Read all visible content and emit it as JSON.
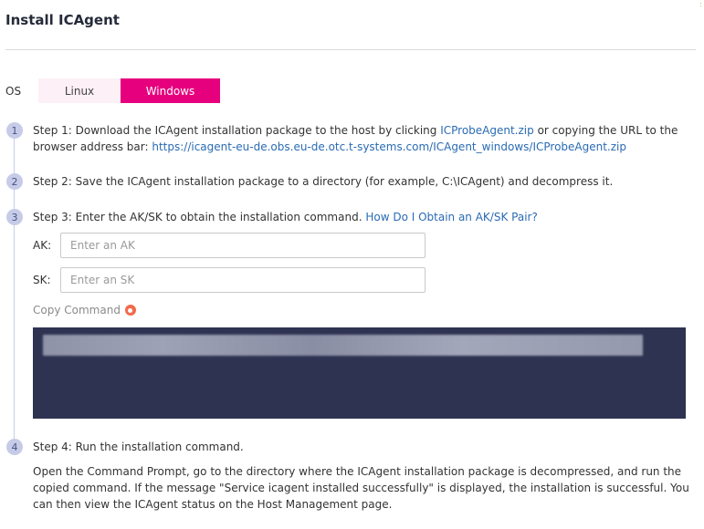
{
  "header": {
    "title": "Install ICAgent"
  },
  "os": {
    "label": "OS",
    "tabs": [
      {
        "label": "Linux",
        "selected": false
      },
      {
        "label": "Windows",
        "selected": true
      }
    ]
  },
  "steps": [
    {
      "number": "1",
      "text_before": "Step 1: Download the ICAgent installation package to the host by clicking ",
      "link1": "ICProbeAgent.zip",
      "text_middle": " or copying the URL to the browser address bar: ",
      "link2": "https://icagent-eu-de.obs.eu-de.otc.t-systems.com/ICAgent_windows/ICProbeAgent.zip"
    },
    {
      "number": "2",
      "text": "Step 2: Save the ICAgent installation package to a directory (for example, C:\\ICAgent) and decompress it."
    },
    {
      "number": "3",
      "text": "Step 3: Enter the AK/SK to obtain the installation command. ",
      "link": "How Do I Obtain an AK/SK Pair?",
      "ak_label": "AK:",
      "ak_placeholder": "Enter an AK",
      "sk_label": "SK:",
      "sk_placeholder": "Enter an SK",
      "copy_label": "Copy Command"
    },
    {
      "number": "4",
      "text": "Step 4: Run the installation command.",
      "description": "Open the Command Prompt, go to the directory where the ICAgent installation package is decompressed, and run the copied command. If the message \"Service icagent installed successfully\" is displayed, the installation is successful. You can then view the ICAgent status on the Host Management page."
    }
  ],
  "colors": {
    "accent": "#e6007e",
    "link": "#2a6bb3",
    "step_badge": "#c6cce8",
    "command_bg": "#2e3352"
  },
  "icons": {
    "copy": "copy-icon"
  }
}
